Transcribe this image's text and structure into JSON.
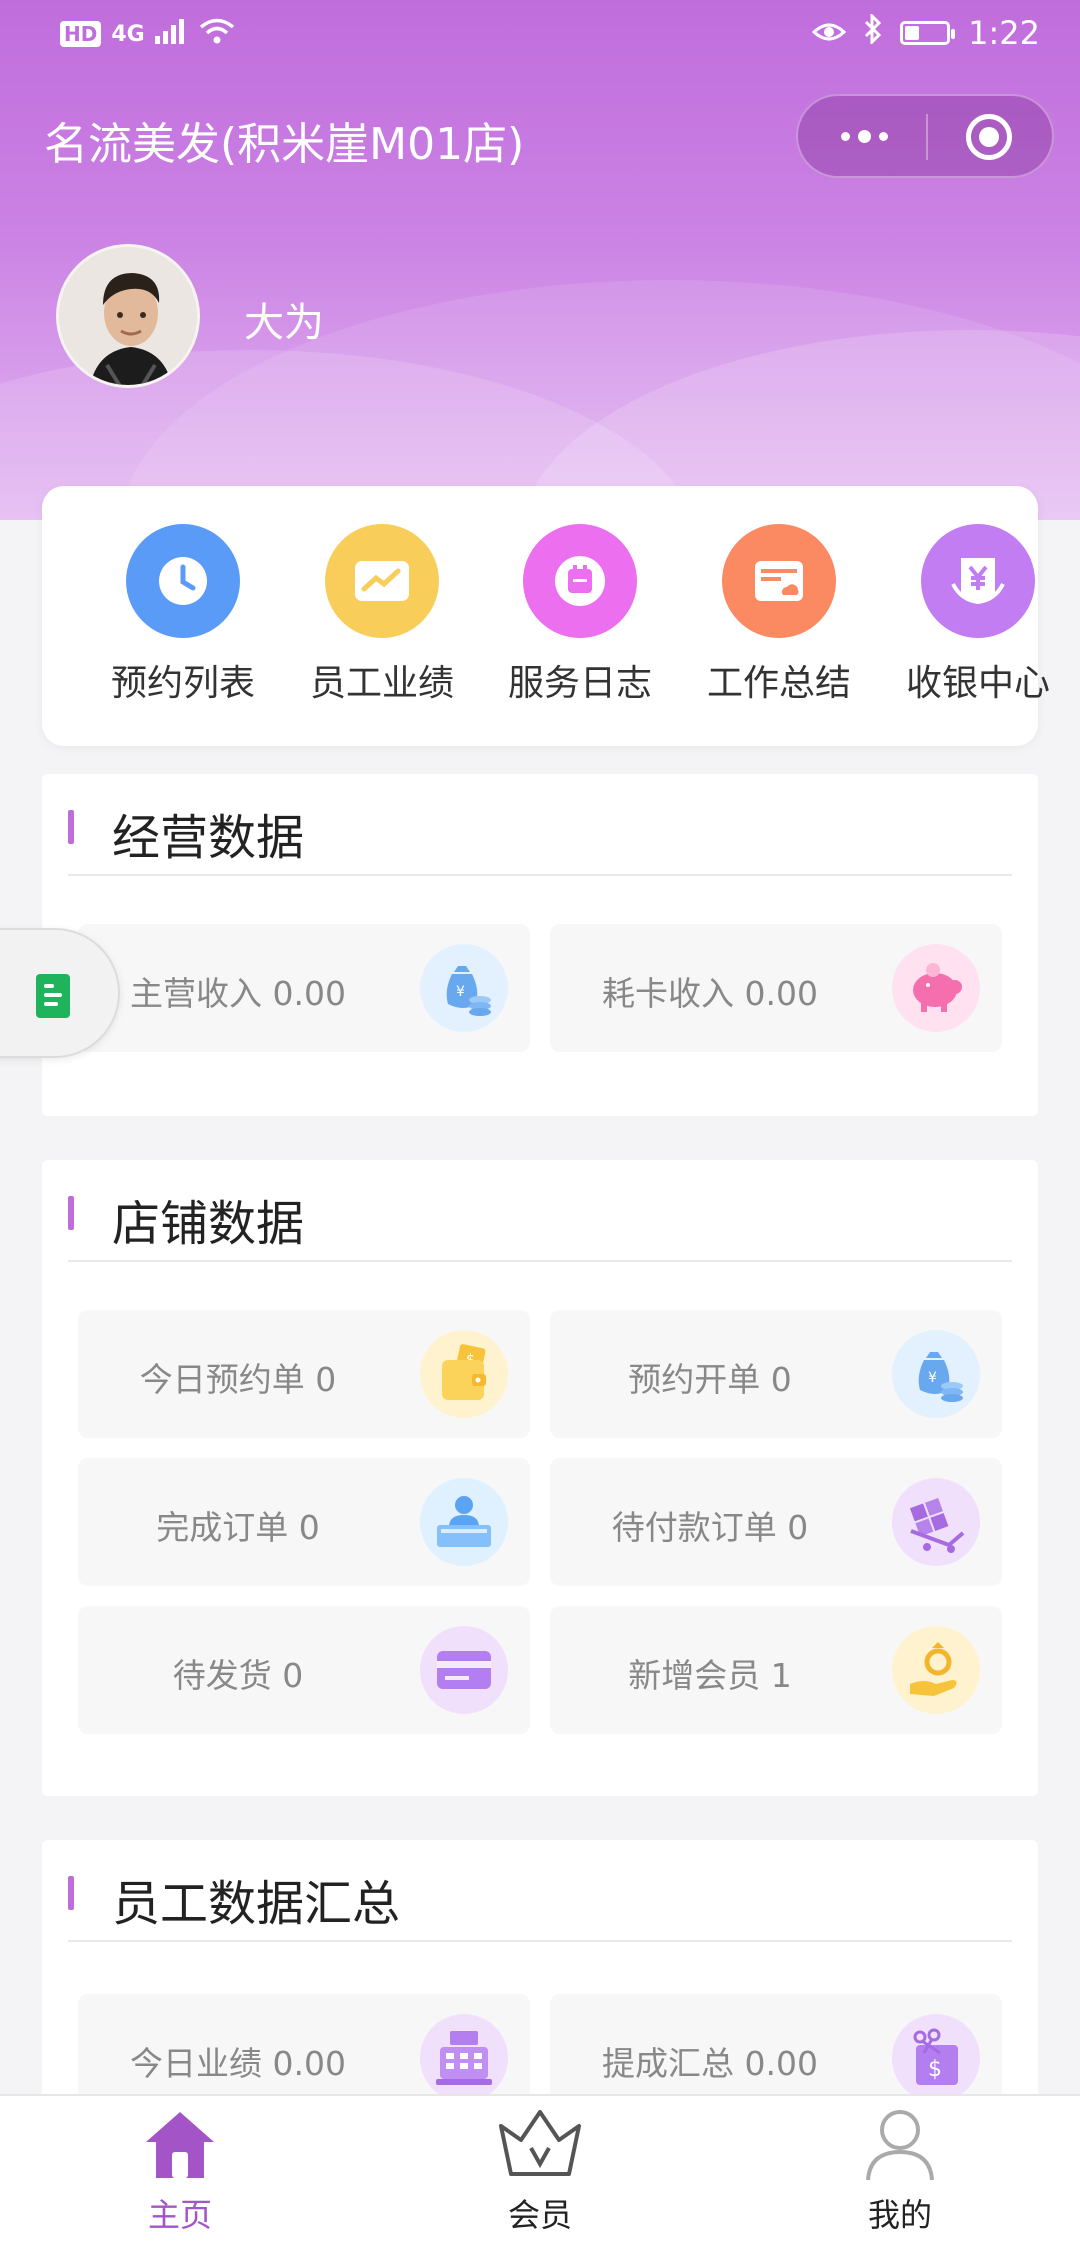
{
  "status_bar": {
    "badge": "HD",
    "network": "4G",
    "time": "1:22"
  },
  "header": {
    "title": "名流美发(积米崖M01店)",
    "username": "大为"
  },
  "quick_actions": [
    {
      "label": "预约列表",
      "icon": "clock-icon",
      "color": "#5b9bf8"
    },
    {
      "label": "员工业绩",
      "icon": "trend-chart-icon",
      "color": "#f9cd5a"
    },
    {
      "label": "服务日志",
      "icon": "calendar-icon",
      "color": "#ec6ff0"
    },
    {
      "label": "工作总结",
      "icon": "cloud-card-icon",
      "color": "#fb8a62"
    },
    {
      "label": "收银中心",
      "icon": "yen-register-icon",
      "color": "#c27df2"
    }
  ],
  "sections": {
    "business": {
      "title": "经营数据",
      "tiles": [
        {
          "label": "主营收入 0.00",
          "icon": "money-bag-icon"
        },
        {
          "label": "耗卡收入 0.00",
          "icon": "piggy-bank-icon"
        }
      ]
    },
    "store": {
      "title": "店铺数据",
      "tiles": [
        {
          "label": "今日预约单 0",
          "icon": "wallet-icon"
        },
        {
          "label": "预约开单 0",
          "icon": "money-bag-icon"
        },
        {
          "label": "完成订单 0",
          "icon": "reception-icon"
        },
        {
          "label": "待付款订单 0",
          "icon": "cart-icon"
        },
        {
          "label": "待发货 0",
          "icon": "card-icon"
        },
        {
          "label": "新增会员 1",
          "icon": "ring-hand-icon"
        }
      ]
    },
    "staff": {
      "title": "员工数据汇总",
      "tiles": [
        {
          "label": "今日业绩 0.00",
          "icon": "cash-register-icon"
        },
        {
          "label": "提成汇总 0.00",
          "icon": "commission-box-icon"
        }
      ]
    }
  },
  "tab_bar": {
    "items": [
      {
        "label": "主页",
        "icon": "home-icon",
        "active": true
      },
      {
        "label": "会员",
        "icon": "crown-icon",
        "active": false
      },
      {
        "label": "我的",
        "icon": "user-icon",
        "active": false
      }
    ],
    "active_color": "#a355c8"
  },
  "colors": {
    "accent": "#c06ddc"
  }
}
